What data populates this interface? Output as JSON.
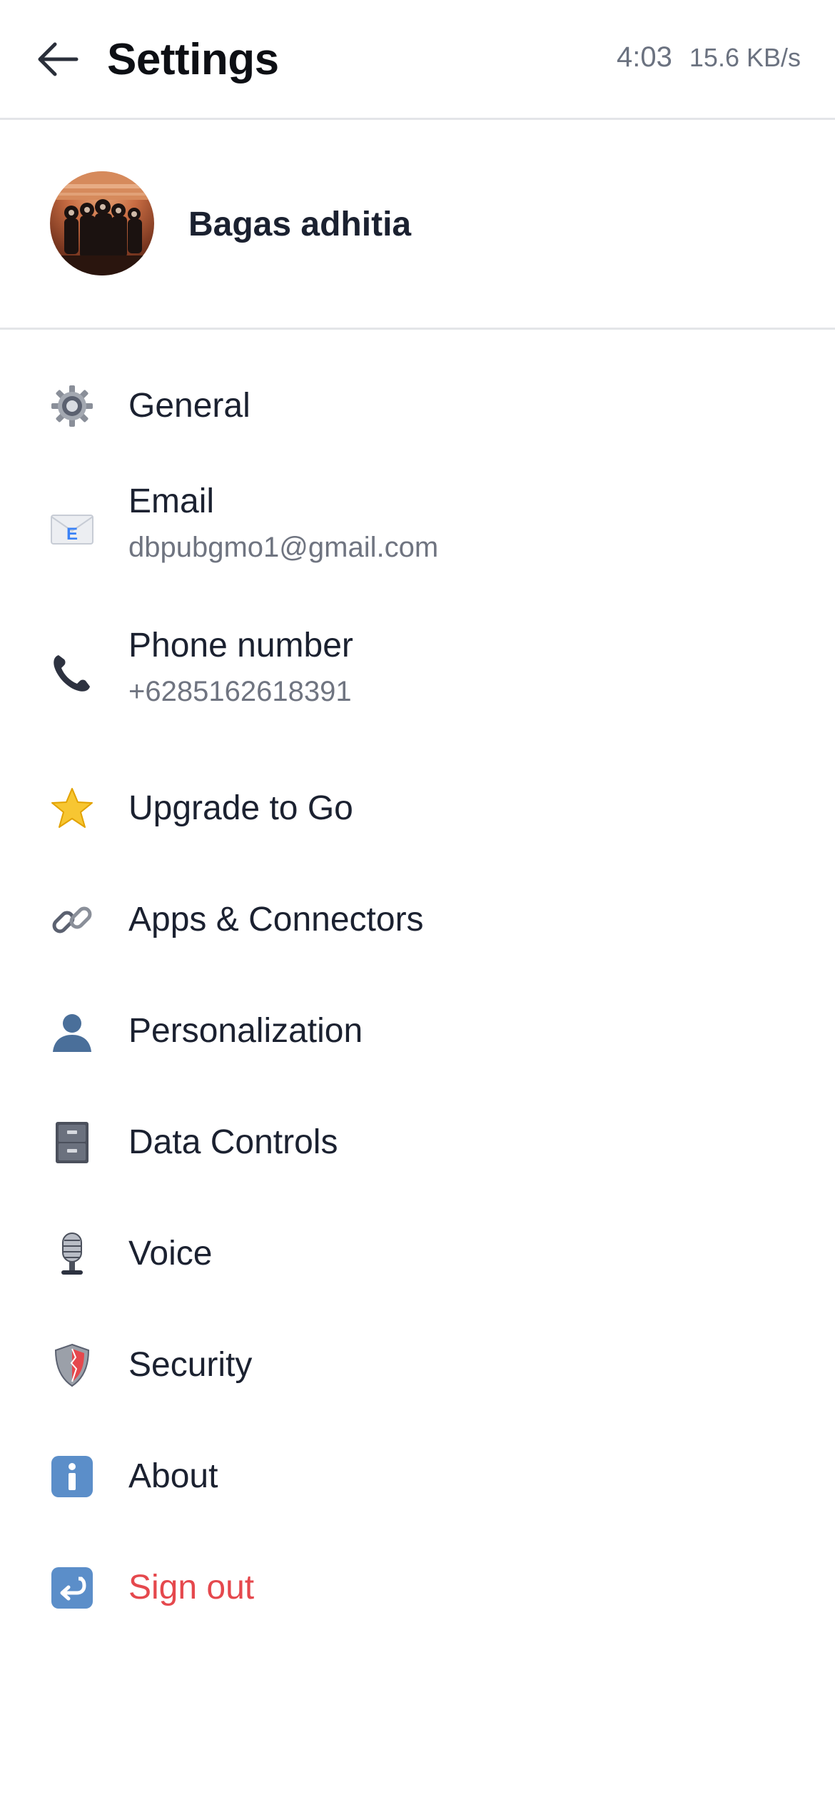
{
  "header": {
    "title": "Settings",
    "clock": "4:03",
    "network_speed": "15.6 KB/s",
    "back_icon": "arrow-left-icon"
  },
  "profile": {
    "name": "Bagas adhitia",
    "avatar_icon": "user-avatar"
  },
  "menu": {
    "items": [
      {
        "label": "General",
        "icon": "gear-icon"
      },
      {
        "label": "Email",
        "value": "dbpubgmo1@gmail.com",
        "icon": "envelope-icon"
      },
      {
        "label": "Phone number",
        "value": "+6285162618391",
        "icon": "phone-icon"
      },
      {
        "label": "Upgrade to Go",
        "icon": "star-icon"
      },
      {
        "label": "Apps & Connectors",
        "icon": "link-icon"
      },
      {
        "label": "Personalization",
        "icon": "person-icon"
      },
      {
        "label": "Data Controls",
        "icon": "file-cabinet-icon"
      },
      {
        "label": "Voice",
        "icon": "microphone-icon"
      },
      {
        "label": "Security",
        "icon": "shield-icon"
      },
      {
        "label": "About",
        "icon": "info-icon"
      },
      {
        "label": "Sign out",
        "icon": "return-arrow-icon"
      }
    ]
  },
  "colors": {
    "danger": "#e5484d",
    "divider": "#e3e5e8",
    "secondary_text": "#6f7480"
  }
}
